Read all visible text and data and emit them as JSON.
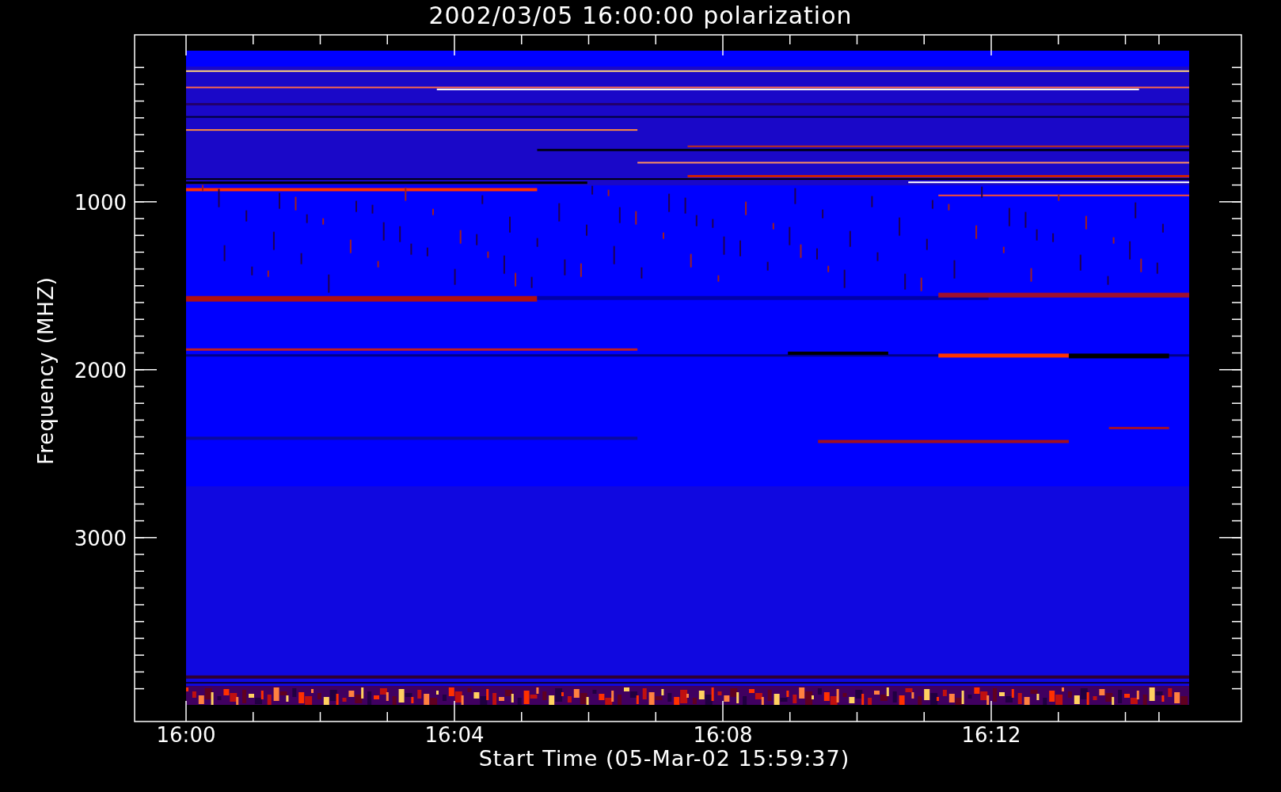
{
  "title": "2002/03/05 16:00:00 polarization",
  "y_axis": {
    "label": "Frequency (MHZ)",
    "ticks": [
      "1000",
      "2000",
      "3000"
    ]
  },
  "x_axis": {
    "label": "Start Time (05-Mar-02 15:59:37)",
    "ticks": [
      "16:00",
      "16:04",
      "16:08",
      "16:12"
    ]
  }
}
